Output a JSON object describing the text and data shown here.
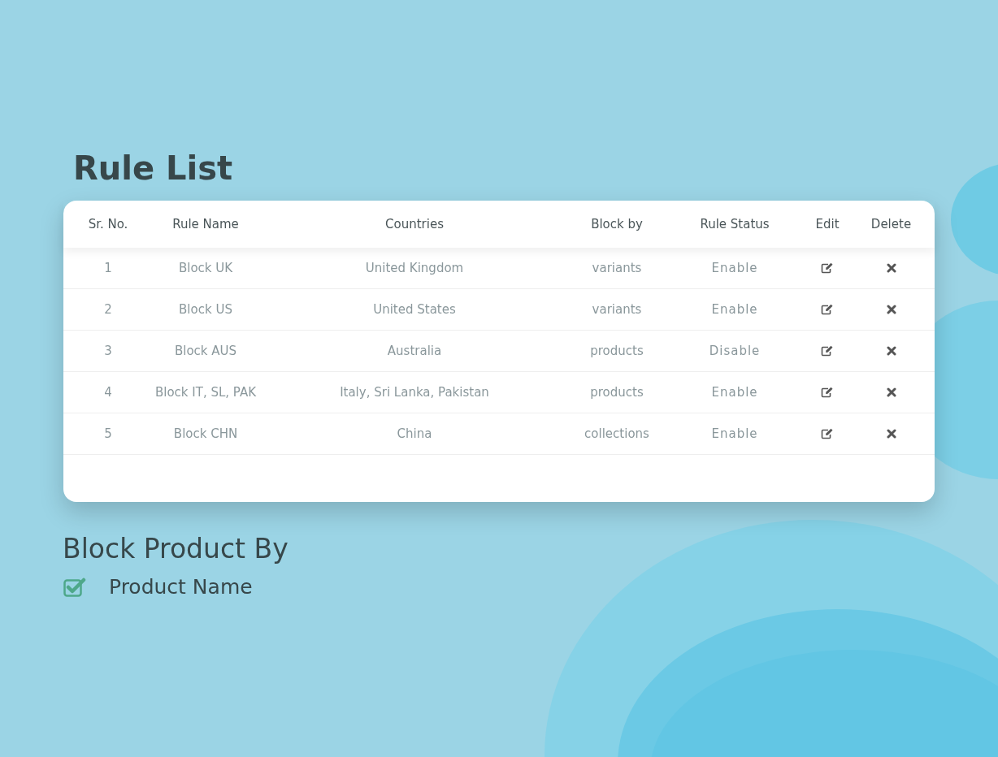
{
  "title": "Rule List",
  "table": {
    "columns": [
      "Sr. No.",
      "Rule Name",
      "Countries",
      "Block by",
      "Rule Status",
      "Edit",
      "Delete"
    ],
    "rows": [
      {
        "sr": "1",
        "rule_name": "Block UK",
        "countries": "United Kingdom",
        "block_by": "variants",
        "status": "Enable"
      },
      {
        "sr": "2",
        "rule_name": "Block US",
        "countries": "United States",
        "block_by": "variants",
        "status": "Enable"
      },
      {
        "sr": "3",
        "rule_name": "Block AUS",
        "countries": "Australia",
        "block_by": "products",
        "status": "Disable"
      },
      {
        "sr": "4",
        "rule_name": "Block IT, SL, PAK",
        "countries": "Italy, Sri Lanka, Pakistan",
        "block_by": "products",
        "status": "Enable"
      },
      {
        "sr": "5",
        "rule_name": "Block CHN",
        "countries": "China",
        "block_by": "collections",
        "status": "Enable"
      }
    ]
  },
  "block_product_by": {
    "heading": "Block Product By",
    "options": [
      {
        "label": "Product Name",
        "checked": true
      }
    ]
  }
}
